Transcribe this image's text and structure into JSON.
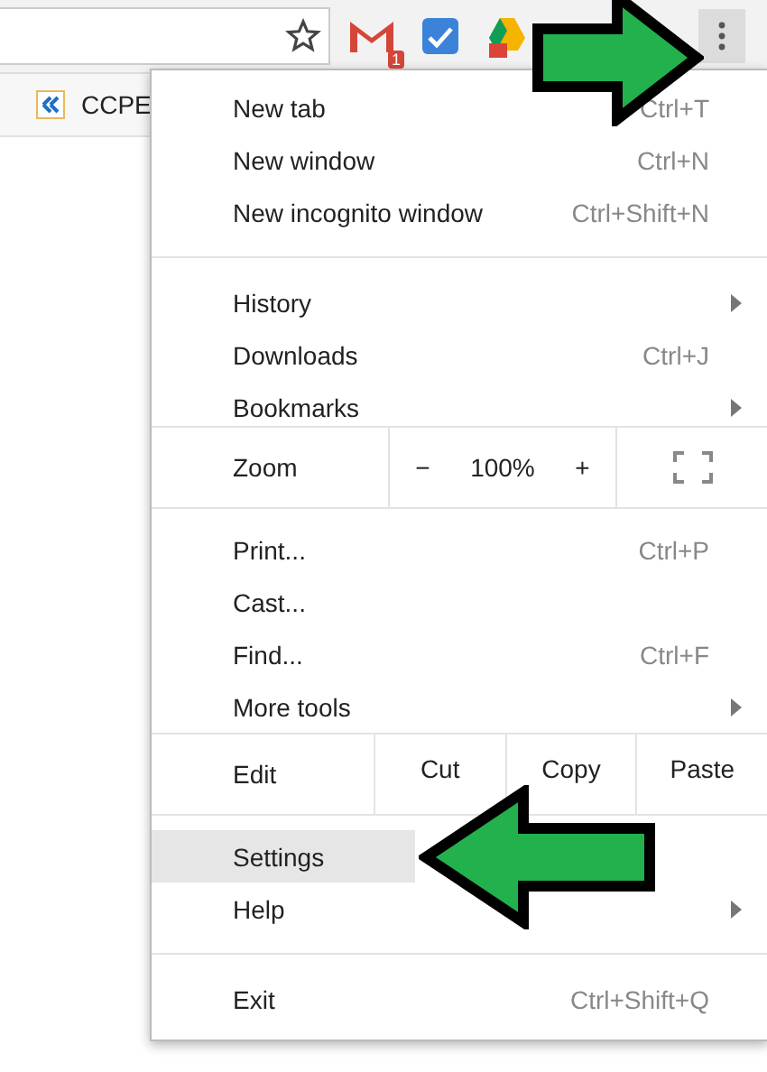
{
  "toolbar": {
    "extensions": [
      {
        "kind": "mail",
        "badge": "1"
      },
      {
        "kind": "check"
      },
      {
        "kind": "drive"
      }
    ]
  },
  "bookmarks": [
    {
      "label": "CCPE"
    }
  ],
  "menu": [
    {
      "kind": "item",
      "label": "New tab",
      "shortcut": "Ctrl+T",
      "submenu": false,
      "selected": false
    },
    {
      "kind": "item",
      "label": "New window",
      "shortcut": "Ctrl+N",
      "submenu": false,
      "selected": false
    },
    {
      "kind": "item",
      "label": "New incognito window",
      "shortcut": "Ctrl+Shift+N",
      "submenu": false,
      "selected": false
    },
    {
      "kind": "separator"
    },
    {
      "kind": "item",
      "label": "History",
      "submenu": true,
      "selected": false
    },
    {
      "kind": "item",
      "label": "Downloads",
      "shortcut": "Ctrl+J",
      "submenu": false,
      "selected": false
    },
    {
      "kind": "item",
      "label": "Bookmarks",
      "submenu": true,
      "selected": false
    },
    {
      "kind": "zoom",
      "label": "Zoom",
      "minus": "−",
      "value": "100%",
      "plus": "+"
    },
    {
      "kind": "item",
      "label": "Print...",
      "shortcut": "Ctrl+P",
      "submenu": false,
      "selected": false
    },
    {
      "kind": "item",
      "label": "Cast...",
      "submenu": false,
      "selected": false
    },
    {
      "kind": "item",
      "label": "Find...",
      "shortcut": "Ctrl+F",
      "submenu": false,
      "selected": false
    },
    {
      "kind": "item",
      "label": "More tools",
      "submenu": true,
      "selected": false
    },
    {
      "kind": "edit",
      "label": "Edit",
      "buttons": [
        "Cut",
        "Copy",
        "Paste"
      ]
    },
    {
      "kind": "item",
      "label": "Settings",
      "submenu": false,
      "selected": true
    },
    {
      "kind": "item",
      "label": "Help",
      "submenu": true,
      "selected": false
    },
    {
      "kind": "separator"
    },
    {
      "kind": "item",
      "label": "Exit",
      "shortcut": "Ctrl+Shift+Q",
      "submenu": false,
      "selected": false
    }
  ]
}
